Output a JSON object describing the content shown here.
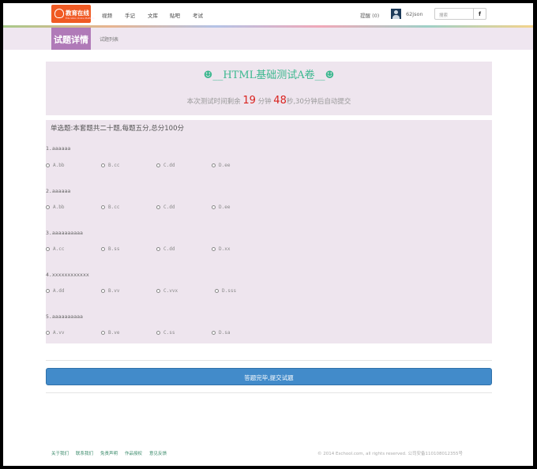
{
  "header": {
    "logo_text": "教育在线",
    "logo_sub": "Education Online Platform",
    "nav": [
      "视频",
      "手记",
      "文库",
      "贴吧",
      "考试"
    ],
    "remind": "提醒 (0)",
    "username": "62json",
    "search_placeholder": "搜索",
    "search_icon_glyph": "f"
  },
  "subheader": {
    "title": "试题详情",
    "link": "试题列表"
  },
  "exam": {
    "title": "☻__HTML基础测试A卷__☻",
    "timer_prefix": "本次测试时间剩余",
    "minutes": "19",
    "min_label": "分钟",
    "seconds": "48",
    "timer_suffix": "秒,30分钟后自动提交"
  },
  "intro": "单选题:本套题共二十题,每题五分,总分100分",
  "questions": [
    {
      "title": "1.aaaaaa",
      "options": [
        "A.bb",
        "B.cc",
        "C.dd",
        "D.ee"
      ]
    },
    {
      "title": "2.aaaaaa",
      "options": [
        "A.bb",
        "B.cc",
        "C.dd",
        "D.ee"
      ]
    },
    {
      "title": "3.aaaaaaaaaa",
      "options": [
        "A.cc",
        "B.ss",
        "C.dd",
        "D.xx"
      ]
    },
    {
      "title": "4.xxxxxxxxxxxx",
      "options": [
        "A.dd",
        "B.vv",
        "C.vvx",
        "D.sss"
      ]
    },
    {
      "title": "5.aaaaaaaaaa",
      "options": [
        "A.vv",
        "B.ve",
        "C.ss",
        "D.sa"
      ]
    }
  ],
  "submit_label": "答题完毕,提交试题",
  "footer": {
    "links": [
      "关于我们",
      "联系我们",
      "免责声明",
      "作品授权",
      "意见反馈"
    ],
    "copyright": "© 2014 Eschool.com, all rights reserved. 公司安备110108012355号"
  },
  "colors": {
    "brand": "#f05a23",
    "accent": "#b07ab8",
    "title_green": "#3cb88f",
    "timer_red": "#d9221e",
    "submit_blue": "#428bca"
  }
}
